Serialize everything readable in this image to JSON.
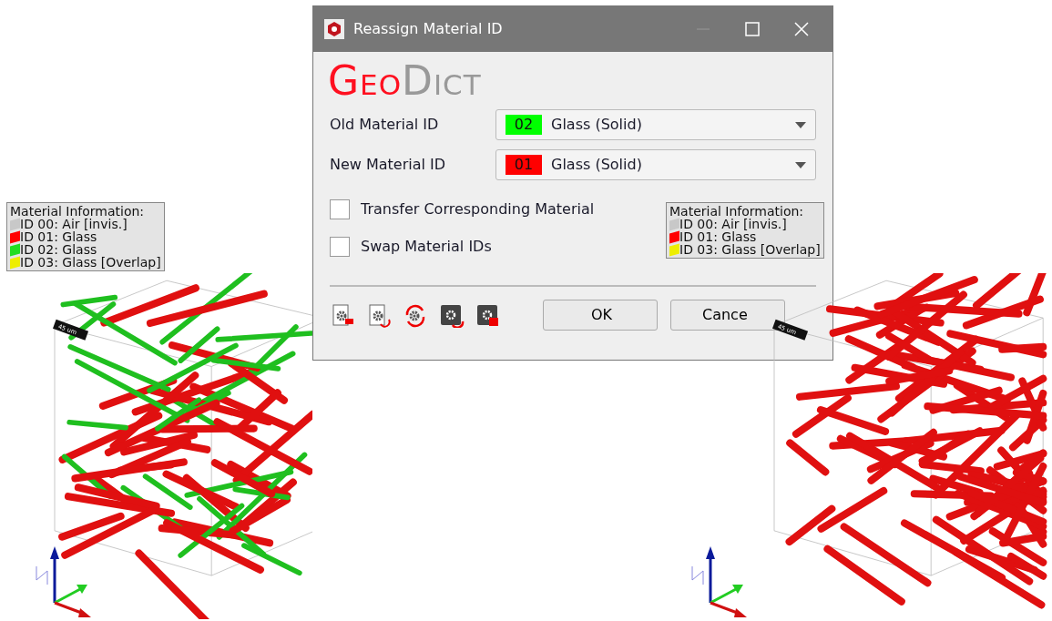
{
  "dialog": {
    "title": "Reassign Material ID",
    "logo": {
      "text_1": "Geo",
      "text_2": "Dict"
    },
    "fields": [
      {
        "label": "Old Material ID",
        "id": "02",
        "value": "Glass (Solid)",
        "color": "#00ff00"
      },
      {
        "label": "New Material ID",
        "id": "01",
        "value": "Glass (Solid)",
        "color": "#ff0000"
      }
    ],
    "checkboxes": [
      {
        "label": "Transfer Corresponding Material",
        "checked": false
      },
      {
        "label": "Swap Material IDs",
        "checked": false
      }
    ],
    "buttons": [
      "OK",
      "Cance"
    ]
  },
  "renders": [
    {
      "legend": {
        "title": "Material Information:",
        "items": [
          {
            "text": "ID 00: Air [invis.]",
            "color": "#c8c8c8"
          },
          {
            "text": "ID 01: Glass",
            "color": "#ff0000"
          },
          {
            "text": "ID 02: Glass",
            "color": "#22dd22"
          },
          {
            "text": "ID 03: Glass [Overlap]",
            "color": "#eeee00"
          }
        ]
      },
      "scale_label": "45 um"
    },
    {
      "legend": {
        "title": "Material Information:",
        "items": [
          {
            "text": "ID 00: Air [invis.]",
            "color": "#c8c8c8"
          },
          {
            "text": "ID 01: Glass",
            "color": "#ff0000"
          },
          {
            "text": "ID 03: Glass [Overlap]",
            "color": "#eeee00"
          }
        ]
      },
      "scale_label": "45 um"
    }
  ]
}
